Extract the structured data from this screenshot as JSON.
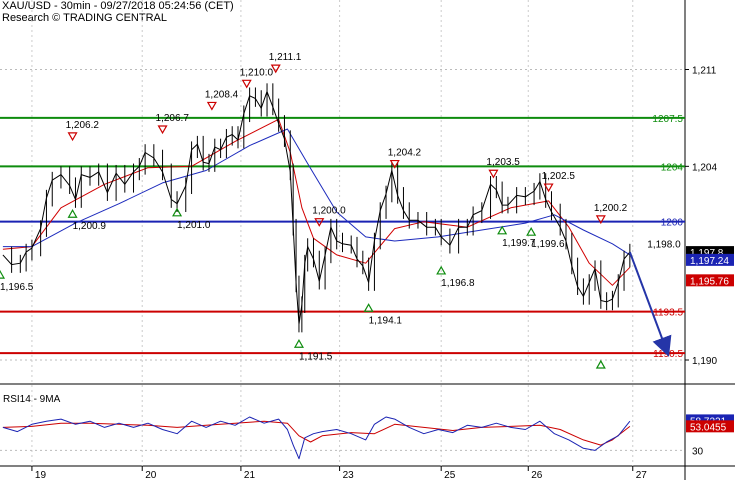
{
  "header": {
    "title": "XAU/USD - 30min - 09/27/2018 05:24:56 (CET)",
    "source": "Research © TRADING CENTRAL"
  },
  "chart_data": {
    "type": "line",
    "symbol": "XAU/USD",
    "timeframe": "30min",
    "price_axis": {
      "ticks": [
        "1,211",
        "1,204",
        "1,190"
      ],
      "tick_values": [
        1211,
        1204,
        1190
      ],
      "range": [
        1188.7,
        1215.3
      ]
    },
    "x_axis": {
      "ticks": [
        "19",
        "20",
        "21",
        "23",
        "25",
        "26",
        "27"
      ],
      "tick_positions": [
        0,
        38,
        72,
        106,
        141,
        171,
        207
      ],
      "range": [
        -11,
        225
      ]
    },
    "price_series": {
      "name": "XAU/USD",
      "points": [
        [
          -10,
          1197.6
        ],
        [
          -7,
          1196.9
        ],
        [
          -4,
          1197.0
        ],
        [
          -2,
          1197.8
        ],
        [
          0,
          1198.1
        ],
        [
          3,
          1199.5
        ],
        [
          5,
          1201.7
        ],
        [
          7,
          1203.0
        ],
        [
          10,
          1203.4
        ],
        [
          13,
          1202.6
        ],
        [
          15,
          1201.6
        ],
        [
          17,
          1203.4
        ],
        [
          20,
          1203.2
        ],
        [
          23,
          1203.6
        ],
        [
          26,
          1202.1
        ],
        [
          29,
          1203.5
        ],
        [
          32,
          1202.7
        ],
        [
          35,
          1203.6
        ],
        [
          37,
          1204.0
        ],
        [
          39,
          1205.0
        ],
        [
          42,
          1204.6
        ],
        [
          45,
          1203.6
        ],
        [
          48,
          1201.6
        ],
        [
          50,
          1201.3
        ],
        [
          53,
          1202.6
        ],
        [
          55,
          1205.2
        ],
        [
          57,
          1205.6
        ],
        [
          59,
          1204.3
        ],
        [
          61,
          1204.2
        ],
        [
          63,
          1205.4
        ],
        [
          65,
          1205.2
        ],
        [
          67,
          1206.1
        ],
        [
          69,
          1206.3
        ],
        [
          71,
          1205.9
        ],
        [
          73,
          1207.8
        ],
        [
          75,
          1209.1
        ],
        [
          77,
          1208.9
        ],
        [
          79,
          1208.2
        ],
        [
          81,
          1209.4
        ],
        [
          83,
          1208.3
        ],
        [
          85,
          1207.1
        ],
        [
          87,
          1206.0
        ],
        [
          89,
          1203.6
        ],
        [
          90,
          1199.6
        ],
        [
          91,
          1195.5
        ],
        [
          92,
          1192.6
        ],
        [
          93,
          1194.0
        ],
        [
          94,
          1197.0
        ],
        [
          95,
          1198.2
        ],
        [
          97,
          1197.3
        ],
        [
          99,
          1195.7
        ],
        [
          101,
          1197.6
        ],
        [
          103,
          1199.6
        ],
        [
          105,
          1198.6
        ],
        [
          107,
          1198.4
        ],
        [
          110,
          1198.3
        ],
        [
          112,
          1197.3
        ],
        [
          114,
          1196.8
        ],
        [
          116,
          1195.6
        ],
        [
          118,
          1198.6
        ],
        [
          120,
          1200.8
        ],
        [
          122,
          1202.0
        ],
        [
          124,
          1203.7
        ],
        [
          126,
          1201.9
        ],
        [
          128,
          1200.8
        ],
        [
          130,
          1200.1
        ],
        [
          133,
          1200.1
        ],
        [
          136,
          1199.6
        ],
        [
          139,
          1199.6
        ],
        [
          141,
          1198.9
        ],
        [
          144,
          1198.3
        ],
        [
          147,
          1199.6
        ],
        [
          150,
          1199.6
        ],
        [
          152,
          1200.5
        ],
        [
          155,
          1200.8
        ],
        [
          158,
          1202.7
        ],
        [
          160,
          1202.3
        ],
        [
          162,
          1201.2
        ],
        [
          164,
          1201.2
        ],
        [
          167,
          1201.9
        ],
        [
          170,
          1201.8
        ],
        [
          173,
          1202.2
        ],
        [
          175,
          1202.9
        ],
        [
          177,
          1201.6
        ],
        [
          179,
          1200.7
        ],
        [
          182,
          1199.6
        ],
        [
          184,
          1198.6
        ],
        [
          186,
          1196.8
        ],
        [
          188,
          1195.3
        ],
        [
          190,
          1194.6
        ],
        [
          192,
          1195.6
        ],
        [
          194,
          1196.6
        ],
        [
          196,
          1194.3
        ],
        [
          198,
          1194.2
        ],
        [
          200,
          1194.4
        ],
        [
          202,
          1195.6
        ],
        [
          204,
          1197.3
        ],
        [
          206,
          1197.8
        ]
      ]
    },
    "moving_averages": [
      {
        "color": "#d10000",
        "points": [
          [
            -10,
            1198.0
          ],
          [
            0,
            1198.2
          ],
          [
            10,
            1201.0
          ],
          [
            25,
            1202.7
          ],
          [
            40,
            1203.9
          ],
          [
            55,
            1204.0
          ],
          [
            70,
            1205.8
          ],
          [
            85,
            1207.4
          ],
          [
            89,
            1205.0
          ],
          [
            93,
            1201.0
          ],
          [
            97,
            1198.8
          ],
          [
            105,
            1197.6
          ],
          [
            115,
            1197.0
          ],
          [
            125,
            1199.5
          ],
          [
            135,
            1200.0
          ],
          [
            150,
            1199.6
          ],
          [
            165,
            1201.0
          ],
          [
            178,
            1201.5
          ],
          [
            185,
            1199.6
          ],
          [
            192,
            1197.0
          ],
          [
            200,
            1195.4
          ],
          [
            206,
            1196.7
          ]
        ]
      },
      {
        "color": "#1d2bbd",
        "points": [
          [
            -10,
            1198.2
          ],
          [
            0,
            1198.2
          ],
          [
            15,
            1199.9
          ],
          [
            30,
            1201.3
          ],
          [
            45,
            1202.8
          ],
          [
            60,
            1203.7
          ],
          [
            75,
            1205.5
          ],
          [
            88,
            1206.7
          ],
          [
            95,
            1204.2
          ],
          [
            105,
            1200.7
          ],
          [
            115,
            1198.9
          ],
          [
            125,
            1198.6
          ],
          [
            140,
            1198.9
          ],
          [
            155,
            1199.4
          ],
          [
            170,
            1199.9
          ],
          [
            180,
            1200.5
          ],
          [
            190,
            1199.4
          ],
          [
            200,
            1198.4
          ],
          [
            206,
            1197.6
          ]
        ]
      }
    ],
    "forecast_arrow": {
      "from": [
        206,
        1197.8
      ],
      "to": [
        219,
        1190.5
      ],
      "color": "#2535a8"
    },
    "horizontal_levels": [
      {
        "value": 1207.5,
        "label": "1207.5",
        "color": "#0e8c0e"
      },
      {
        "value": 1204.0,
        "label": "1204",
        "color": "#0e8c0e"
      },
      {
        "value": 1200.0,
        "label": "1200",
        "color": "#1a23b3"
      },
      {
        "value": 1193.5,
        "label": "1193.5",
        "color": "#cc0000"
      },
      {
        "value": 1190.5,
        "label": "1190.5",
        "color": "#cc0000"
      }
    ],
    "price_tags": [
      {
        "value": 1197.8,
        "label": "1,197.8",
        "color": "#000000"
      },
      {
        "value": 1197.24,
        "label": "1,197.24",
        "color": "#1a23b3"
      },
      {
        "value": 1195.76,
        "label": "1,195.76",
        "color": "#cc0000"
      }
    ],
    "annotations": [
      {
        "kind": "low",
        "t": -11,
        "value": 1196.5,
        "label": "1,196.5"
      },
      {
        "kind": "low",
        "t": 14,
        "value": 1200.9,
        "label": "1,200.9"
      },
      {
        "kind": "high",
        "t": 14,
        "value": 1206.2,
        "label": "1,206.2"
      },
      {
        "kind": "high",
        "t": 45,
        "value": 1206.7,
        "label": "1,206.7"
      },
      {
        "kind": "low",
        "t": 50,
        "value": 1201.0,
        "label": "1,201.0"
      },
      {
        "kind": "high",
        "t": 62,
        "value": 1208.4,
        "label": "1,208.4"
      },
      {
        "kind": "high",
        "t": 74,
        "value": 1210.0,
        "label": "1,210.0"
      },
      {
        "kind": "high",
        "t": 84,
        "value": 1211.1,
        "label": "1,211.1"
      },
      {
        "kind": "low",
        "t": 92,
        "value": 1191.5,
        "label": "1,191.5"
      },
      {
        "kind": "high",
        "t": 99,
        "value": 1200.0,
        "label": "1,200.0"
      },
      {
        "kind": "low",
        "t": 116,
        "value": 1194.1,
        "label": "1,194.1"
      },
      {
        "kind": "high",
        "t": 125,
        "value": 1204.2,
        "label": "1,204.2"
      },
      {
        "kind": "low",
        "t": 141,
        "value": 1196.8,
        "label": "1,196.8"
      },
      {
        "kind": "high",
        "t": 159,
        "value": 1203.5,
        "label": "1,203.5"
      },
      {
        "kind": "low",
        "t": 162,
        "value": 1199.7,
        "label": "1,199.7"
      },
      {
        "kind": "low",
        "t": 172,
        "value": 1199.6,
        "label": "1,199.6"
      },
      {
        "kind": "high",
        "t": 178,
        "value": 1202.5,
        "label": "1,202.5"
      },
      {
        "kind": "high",
        "t": 196,
        "value": 1200.2,
        "label": "1,200.2"
      },
      {
        "kind": "low",
        "t": 196,
        "value": 1190.0,
        "label": ""
      },
      {
        "kind": "text",
        "t": 212,
        "value": 1198.0,
        "label": "1,198.0"
      }
    ],
    "rsi_panel": {
      "title": "RSI14 - 9MA",
      "ticks": [
        "30"
      ],
      "tick_values": [
        30
      ],
      "range": [
        15,
        85
      ],
      "current": [
        {
          "value": 58.7221,
          "label": "58.7221",
          "color": "#1a23b3"
        },
        {
          "value": 53.0455,
          "label": "53.0455",
          "color": "#cc0000"
        }
      ],
      "rsi_series": [
        [
          -10,
          52
        ],
        [
          -5,
          48
        ],
        [
          0,
          55
        ],
        [
          5,
          58
        ],
        [
          10,
          60
        ],
        [
          15,
          55
        ],
        [
          20,
          58
        ],
        [
          25,
          52
        ],
        [
          30,
          56
        ],
        [
          35,
          52
        ],
        [
          40,
          56
        ],
        [
          45,
          50
        ],
        [
          50,
          46
        ],
        [
          55,
          58
        ],
        [
          60,
          52
        ],
        [
          65,
          58
        ],
        [
          70,
          54
        ],
        [
          75,
          62
        ],
        [
          80,
          56
        ],
        [
          85,
          60
        ],
        [
          88,
          50
        ],
        [
          90,
          35
        ],
        [
          92,
          22
        ],
        [
          94,
          42
        ],
        [
          97,
          46
        ],
        [
          100,
          48
        ],
        [
          105,
          50
        ],
        [
          110,
          46
        ],
        [
          115,
          40
        ],
        [
          118,
          55
        ],
        [
          122,
          62
        ],
        [
          125,
          60
        ],
        [
          130,
          52
        ],
        [
          135,
          46
        ],
        [
          140,
          50
        ],
        [
          145,
          47
        ],
        [
          150,
          54
        ],
        [
          155,
          52
        ],
        [
          160,
          56
        ],
        [
          165,
          52
        ],
        [
          170,
          50
        ],
        [
          175,
          58
        ],
        [
          180,
          46
        ],
        [
          185,
          40
        ],
        [
          190,
          32
        ],
        [
          194,
          30
        ],
        [
          198,
          38
        ],
        [
          202,
          44
        ],
        [
          206,
          58
        ]
      ],
      "ma_series": [
        [
          -10,
          52
        ],
        [
          0,
          53
        ],
        [
          10,
          56
        ],
        [
          20,
          56
        ],
        [
          30,
          55
        ],
        [
          40,
          54
        ],
        [
          50,
          52
        ],
        [
          60,
          54
        ],
        [
          70,
          56
        ],
        [
          80,
          58
        ],
        [
          88,
          56
        ],
        [
          92,
          44
        ],
        [
          96,
          38
        ],
        [
          100,
          44
        ],
        [
          110,
          47
        ],
        [
          118,
          46
        ],
        [
          125,
          55
        ],
        [
          135,
          52
        ],
        [
          145,
          49
        ],
        [
          155,
          52
        ],
        [
          165,
          53
        ],
        [
          175,
          54
        ],
        [
          182,
          50
        ],
        [
          190,
          40
        ],
        [
          196,
          35
        ],
        [
          200,
          40
        ],
        [
          206,
          53
        ]
      ]
    }
  }
}
